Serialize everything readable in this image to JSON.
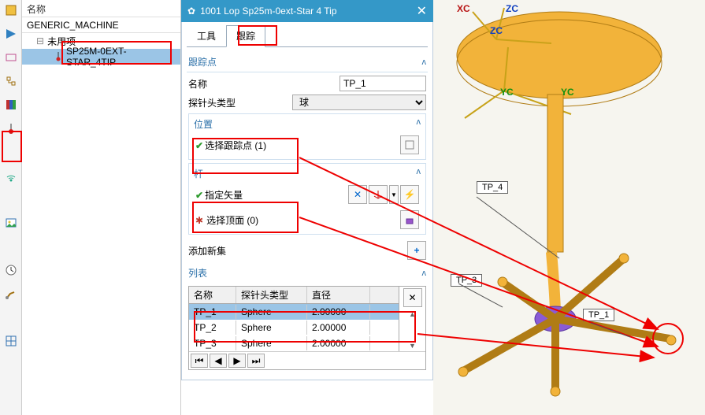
{
  "tree": {
    "header": "名称",
    "machine": "GENERIC_MACHINE",
    "unused": "未用项",
    "item": "SP25M-0EXT-STAR_4TIP"
  },
  "dialog": {
    "title": "1001 Lop Sp25m-0ext-Star 4  Tip",
    "tabs": {
      "tool": "工具",
      "track": "跟踪"
    },
    "track_point": "跟踪点",
    "name_label": "名称",
    "name_value": "TP_1",
    "probe_type_label": "探针头类型",
    "probe_type_value": "球",
    "pos_group": "位置",
    "select_track": "选择跟踪点 (1)",
    "rod_group": "杆",
    "specify_vector": "指定矢量",
    "select_vertex": "选择顶面 (0)",
    "add_set": "添加新集",
    "list": "列表",
    "cols": {
      "name": "名称",
      "type": "探针头类型",
      "dia": "直径"
    },
    "rows": [
      {
        "name": "TP_1",
        "type": "Sphere",
        "dia": "2.00000",
        "sel": true
      },
      {
        "name": "TP_2",
        "type": "Sphere",
        "dia": "2.00000"
      },
      {
        "name": "TP_3",
        "type": "Sphere",
        "dia": "2.00000"
      }
    ]
  },
  "viewport": {
    "axes": {
      "xc": "XC",
      "yc": "YC",
      "zc": "ZC"
    },
    "callouts": {
      "tp1": "TP_1",
      "tp3": "TP_3",
      "tp4": "TP_4"
    }
  }
}
